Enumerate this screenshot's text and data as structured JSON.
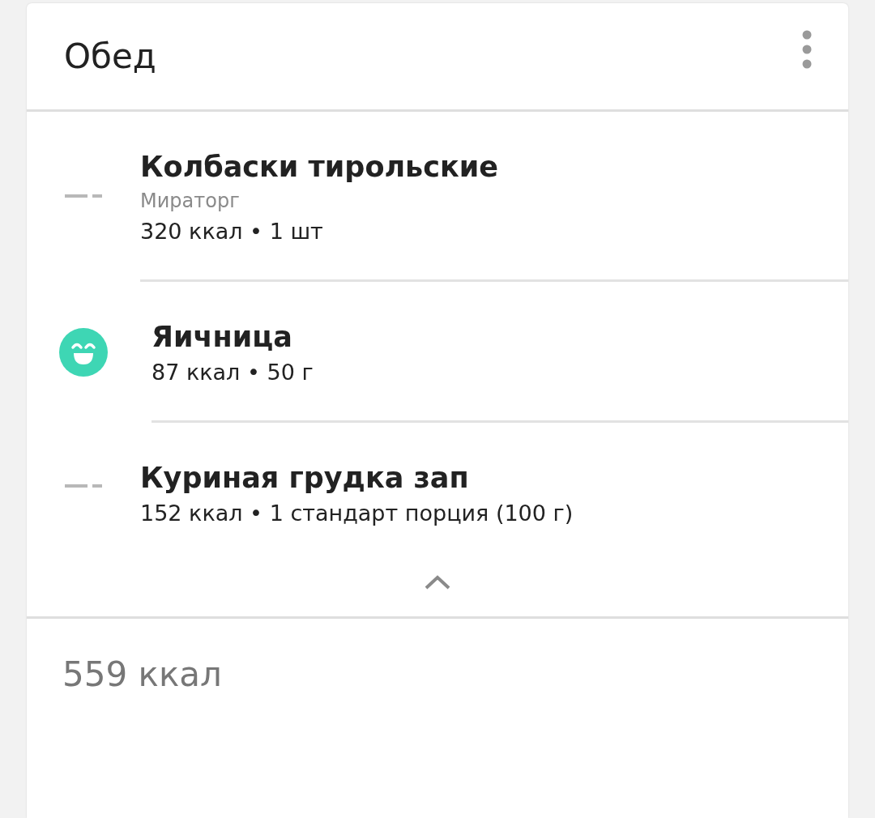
{
  "meal": {
    "title": "Обед"
  },
  "items": [
    {
      "kind": "dash",
      "name": "Колбаски тирольские",
      "brand": "Мираторг",
      "meta": "320 ккал • 1 шт"
    },
    {
      "kind": "smiley",
      "name": "Яичница",
      "meta": "87 ккал • 50 г"
    },
    {
      "kind": "dash",
      "name": "Куриная грудка зап",
      "meta": "152 ккал • 1 стандарт порция (100 г)"
    }
  ],
  "expanded": true,
  "total": "559 ккал"
}
